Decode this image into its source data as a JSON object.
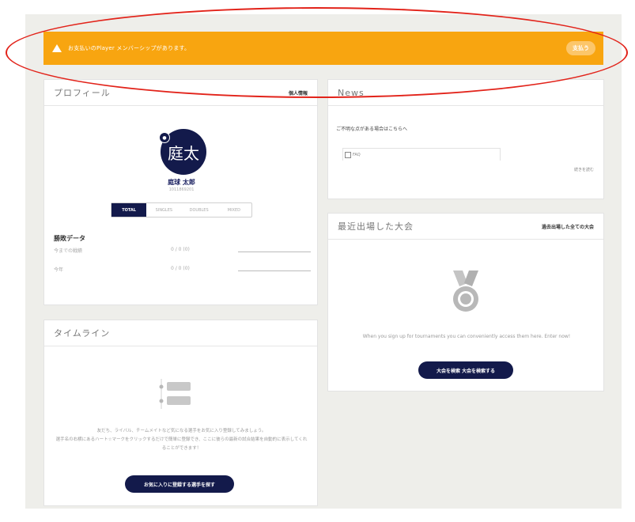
{
  "banner": {
    "message": "お支払いのPlayer メンバーシップがあります。",
    "pay_label": "支払う",
    "color": "#f8a510"
  },
  "profile": {
    "title": "プロフィール",
    "edit_link": "個人情報",
    "avatar_text": "庭太",
    "name": "庭球 太郎",
    "player_id": "1011869201",
    "tabs": [
      "TOTAL",
      "SINGLES",
      "DOUBLES",
      "MIXED"
    ],
    "active_tab": "TOTAL",
    "stats_title": "勝敗データ",
    "stats": [
      {
        "label": "今までの戦績",
        "value": "0 / 0 (0)"
      },
      {
        "label": "今年",
        "value": "0 / 0 (0)"
      }
    ]
  },
  "timeline": {
    "title": "タイムライン",
    "description_line1": "友だち、ライバル、チームメイトなど気になる選手をお気に入り登録してみましょう。",
    "description_line2": "選手名の右横にあるハート☆マークをクリックするだけで簡単に登録でき、ここに彼らの最新の試合結果を自動的に表示してくれることができます！",
    "button_label": "お気に入りに登録する選手を探す"
  },
  "news": {
    "title": "News",
    "help_text": "ご不明な点がある場合はこちらへ",
    "faq_label": "FAQ",
    "more_label": "続きを読む"
  },
  "tournaments": {
    "title": "最近出場した大会",
    "all_link": "過去出場した全ての大会",
    "empty_message": "When you sign up for tournaments you can conveniently access them here. Enter now!",
    "button_label": "大会を検索 大会を検索する"
  },
  "colors": {
    "navy": "#131a4b",
    "annotation": "#e2231a"
  }
}
